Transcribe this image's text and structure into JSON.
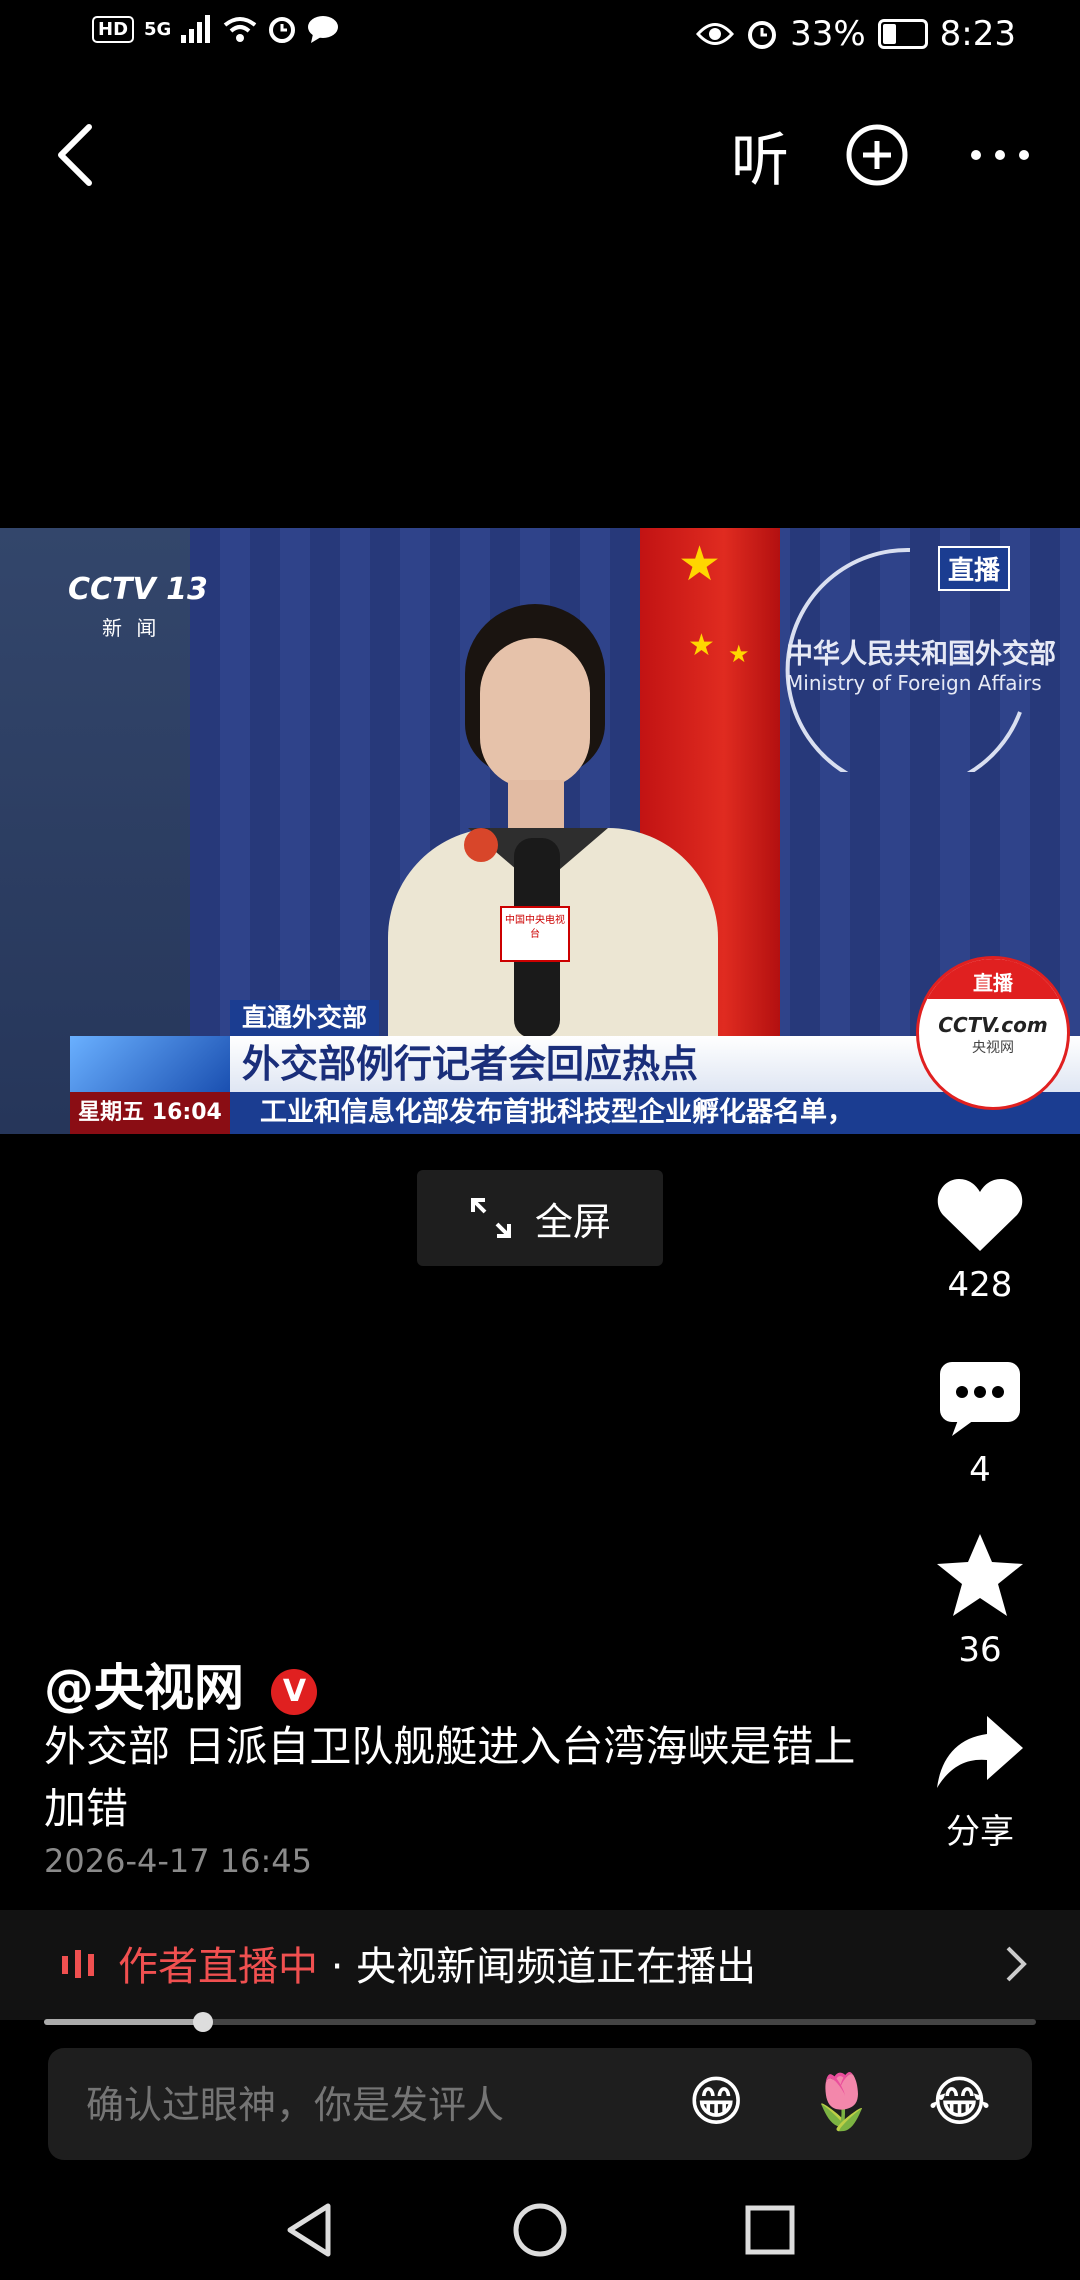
{
  "status_bar": {
    "left_badges": [
      "HD",
      "5G"
    ],
    "battery": "33%",
    "battery_level": 0.33,
    "time": "8:23"
  },
  "top_bar": {
    "listen_label": "听"
  },
  "video": {
    "channel_logo": "CCTV 13",
    "channel_sub": "新 闻",
    "live_tag": "直播",
    "backdrop_cn": "中华人民共和国外交部",
    "backdrop_en": "Ministry of Foreign Affairs",
    "mic_label": "中国中央电视台",
    "lower_third_tag": "直通外交部",
    "lower_third_title": "外交部例行记者会回应热点",
    "day_time": "星期五  16:04",
    "ticker": "工业和信息化部发布首批科技型企业孵化器名单，",
    "corner_live": "直播",
    "corner_logo": "CCTV.com",
    "corner_logo_cn": "央视网"
  },
  "fullscreen_label": "全屏",
  "rail": {
    "likes": "428",
    "comments": "4",
    "favorites": "36",
    "share_label": "分享"
  },
  "post": {
    "author": "@央视网",
    "verified_badge": "V",
    "title": "外交部 日派自卫队舰艇进入台湾海峡是错上加错",
    "date": "2026-4-17 16:45"
  },
  "live_banner": {
    "highlight": "作者直播中",
    "text": " · 央视新闻频道正在播出"
  },
  "progress": 0.16,
  "comment_bar": {
    "placeholder": "确认过眼神，你是发评人",
    "emojis": [
      "😁",
      "🌷",
      "😂"
    ]
  }
}
